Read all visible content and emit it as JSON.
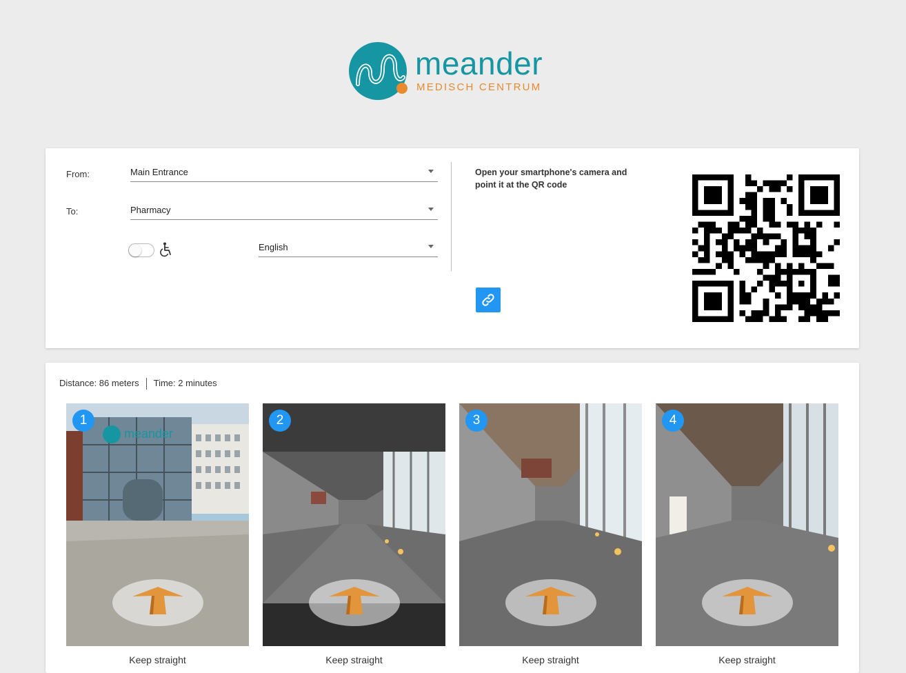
{
  "brand": {
    "name": "meander",
    "subtitle": "MEDISCH CENTRUM",
    "primary_color": "#1696a3",
    "accent_color": "#e98a2e"
  },
  "route_form": {
    "from_label": "From:",
    "from_value": "Main Entrance",
    "to_label": "To:",
    "to_value": "Pharmacy",
    "accessibility_toggle": false,
    "language_value": "English"
  },
  "share": {
    "qr_instruction": "Open your smartphone's camera and point it at the QR code",
    "link_icon": "link-icon"
  },
  "route_summary": {
    "distance": "Distance: 86 meters",
    "time": "Time: 2 minutes"
  },
  "steps": [
    {
      "number": "1",
      "caption": "Keep straight"
    },
    {
      "number": "2",
      "caption": "Keep straight"
    },
    {
      "number": "3",
      "caption": "Keep straight"
    },
    {
      "number": "4",
      "caption": "Keep straight"
    }
  ]
}
